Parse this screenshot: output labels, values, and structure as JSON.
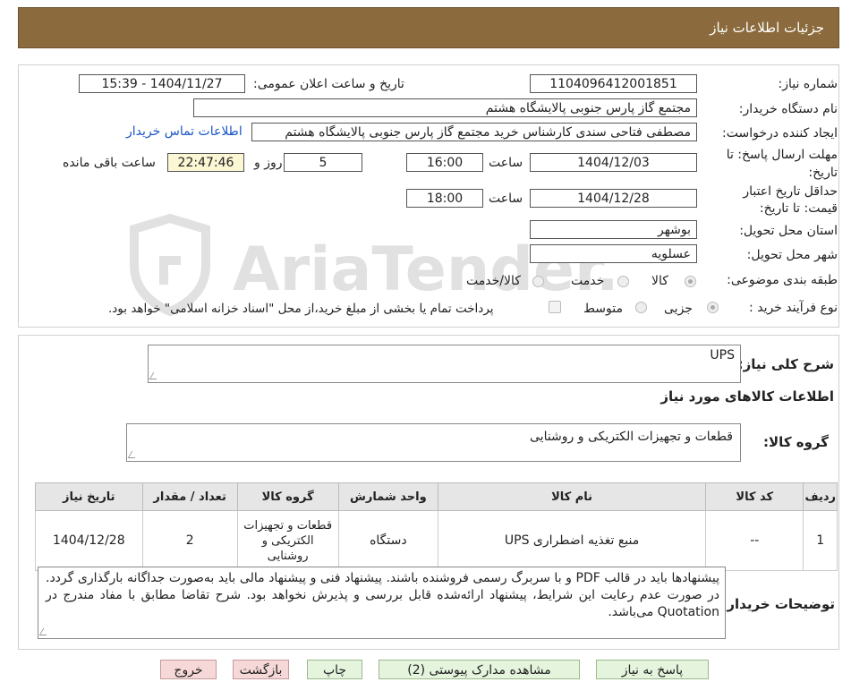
{
  "header": {
    "title": "جزئیات اطلاعات نیاز"
  },
  "watermark": {
    "text": "AriaTender.neT"
  },
  "form": {
    "need_number_label": "شماره نیاز:",
    "need_number": "1104096412001851",
    "announce_label": "تاریخ و ساعت اعلان عمومی:",
    "announce_value": "1404/11/27 - 15:39",
    "buyer_label": "نام دستگاه خریدار:",
    "buyer_value": "مجتمع گاز پارس جنوبی  پالایشگاه هشتم",
    "creator_label": "ایجاد کننده درخواست:",
    "creator_value": "مصطفی فتاحی سندی کارشناس خرید مجتمع گاز پارس جنوبی  پالایشگاه هشتم",
    "contact_link": "اطلاعات تماس خریدار",
    "deadline_label_1": "مهلت ارسال پاسخ: تا",
    "deadline_label_2": "تاریخ:",
    "deadline_date": "1404/12/03",
    "time_label": "ساعت",
    "deadline_time": "16:00",
    "days_value": "5",
    "days_label": "روز و",
    "remaining_time": "22:47:46",
    "remaining_label": "ساعت باقی مانده",
    "validity_label_1": "حداقل تاریخ اعتبار",
    "validity_label_2": "قیمت: تا تاریخ:",
    "validity_date": "1404/12/28",
    "validity_time": "18:00",
    "province_label": "استان محل تحویل:",
    "province_value": "بوشهر",
    "city_label": "شهر محل تحویل:",
    "city_value": "عسلویه",
    "category_label": "طبقه بندی موضوعی:",
    "category_options": [
      "کالا",
      "خدمت",
      "کالا/خدمت"
    ],
    "process_label": "نوع فرآیند خرید :",
    "process_options": [
      "جزیی",
      "متوسط"
    ],
    "payment_note": "پرداخت تمام یا بخشی از مبلغ خرید،از محل \"اسناد خزانه اسلامی\" خواهد بود."
  },
  "summary": {
    "label": "شرح کلی نیاز:",
    "value": "UPS",
    "goods_info_title": "اطلاعات کالاهای مورد نیاز",
    "group_label": "گروه کالا:",
    "group_value": "قطعات و تجهیزات الکتریکی و روشنایی"
  },
  "table": {
    "headers": [
      "ردیف",
      "کد کالا",
      "نام کالا",
      "واحد شمارش",
      "گروه کالا",
      "تعداد / مقدار",
      "تاریخ نیاز"
    ],
    "rows": [
      [
        "1",
        "--",
        "منبع تغذیه اضطراری UPS",
        "دستگاه",
        "قطعات و تجهیزات الکتریکی و روشنایی",
        "2",
        "1404/12/28"
      ]
    ]
  },
  "notes": {
    "label": "توضیحات خریدار:",
    "text": "پیشنهادها باید در قالب PDF و با سربرگ رسمی فروشنده باشند. پیشنهاد فنی و پیشنهاد مالی باید به‌صورت جداگانه بارگذاری گردد. در صورت عدم رعایت این شرایط، پیشنهاد ارائه‌شده قابل بررسی و پذیرش نخواهد بود. شرح تقاضا مطابق با مفاد مندرج در Quotation می‌باشد."
  },
  "buttons": {
    "reply": "پاسخ به نیاز",
    "attachments": "مشاهده مدارک پیوستی (2)",
    "print": "چاپ",
    "back": "بازگشت",
    "exit": "خروج"
  },
  "colors": {
    "header_bg": "#8b6b3d",
    "link": "#1a55c7",
    "green_btn": "#e4f4dd",
    "red_btn": "#f7d8d8"
  }
}
